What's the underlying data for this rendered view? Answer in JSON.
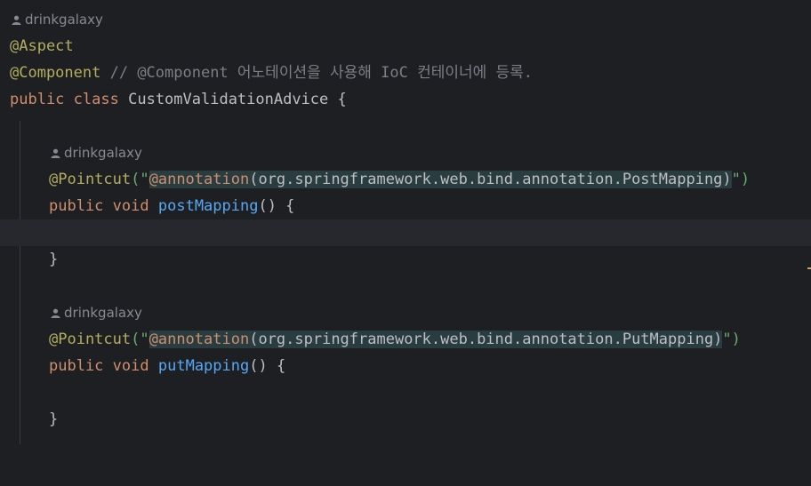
{
  "author": "drinkgalaxy",
  "lines": {
    "l1": "@Aspect",
    "l2_ann": "@Component",
    "l2_comment": "// @Component 어노테이션을 사용해 IoC 컨테이너에 등록.",
    "l3_kw1": "public",
    "l3_kw2": "class",
    "l3_name": "CustomValidationAdvice {",
    "pointcut1": {
      "ann": "@Pointcut",
      "open": "(\"",
      "inj_at": "@annotation",
      "inj_rest": "(org.springframework.web.bind.annotation.PostMapping)",
      "close": "\")"
    },
    "method1": {
      "kw1": "public",
      "kw2": "void",
      "name": "postMapping",
      "rest": "() {"
    },
    "close1": "}",
    "pointcut2": {
      "ann": "@Pointcut",
      "open": "(\"",
      "inj_at": "@annotation",
      "inj_rest": "(org.springframework.web.bind.annotation.PutMapping)",
      "close": "\")"
    },
    "method2": {
      "kw1": "public",
      "kw2": "void",
      "name": "putMapping",
      "rest": "() {"
    },
    "close2": "}"
  },
  "icons": {
    "author_hint": "person-icon"
  },
  "colors": {
    "background": "#1e1f22",
    "caret_line": "#26282e",
    "annotation": "#b3ae60",
    "keyword": "#cf8e6d",
    "comment": "#7a7e85",
    "function": "#56a8f5",
    "string": "#6aab73",
    "injected_bg": "#293c40"
  }
}
